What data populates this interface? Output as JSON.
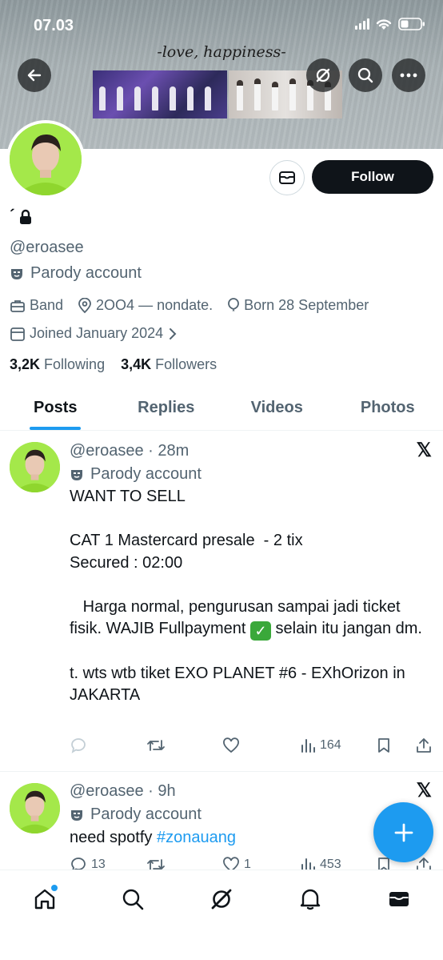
{
  "status_bar": {
    "time": "07.03"
  },
  "banner": {
    "caption": "-love, happiness-"
  },
  "profile": {
    "name": "´",
    "handle": "@eroasee",
    "parody_label": "Parody account",
    "category": "Band",
    "location": "2OO4 — nondate.",
    "born": "Born 28 September",
    "joined": "Joined January 2024",
    "following_count": "3,2K",
    "following_label": "Following",
    "followers_count": "3,4K",
    "followers_label": "Followers"
  },
  "actions": {
    "follow_label": "Follow"
  },
  "tabs": [
    {
      "label": "Posts",
      "active": true
    },
    {
      "label": "Replies",
      "active": false
    },
    {
      "label": "Videos",
      "active": false
    },
    {
      "label": "Photos",
      "active": false
    }
  ],
  "posts": [
    {
      "handle": "@eroasee",
      "time": "28m",
      "parody_label": "Parody account",
      "text_line1": "WANT TO SELL",
      "text_line2": "CAT 1 Mastercard presale  - 2 tix",
      "text_line3": "Secured : 02:00",
      "text_line4a": "   Harga normal, pengurusan sampai jadi ticket fisik. WAJIB Fullpayment ",
      "text_line4b": " selain itu jangan dm.",
      "text_line5": "t. wts wtb tiket EXO PLANET #6 - EXhOrizon in JAKARTA",
      "views": "164"
    },
    {
      "handle": "@eroasee",
      "time": "9h",
      "parody_label": "Parody account",
      "text": "need spotfy ",
      "hashtag": "#zonauang",
      "replies": "13",
      "likes": "1",
      "views": "453"
    }
  ],
  "icons": {
    "back": "back-arrow-icon",
    "grok": "grok-icon",
    "search": "search-icon",
    "more": "more-icon",
    "mail": "mail-icon",
    "lock": "lock-icon",
    "parody": "parody-mask-icon",
    "briefcase": "briefcase-icon",
    "location": "location-pin-icon",
    "balloon": "balloon-icon",
    "calendar": "calendar-icon"
  },
  "colors": {
    "accent": "#1d9bf0",
    "text": "#0f1419",
    "muted": "#536471",
    "check": "#3aa83a"
  }
}
